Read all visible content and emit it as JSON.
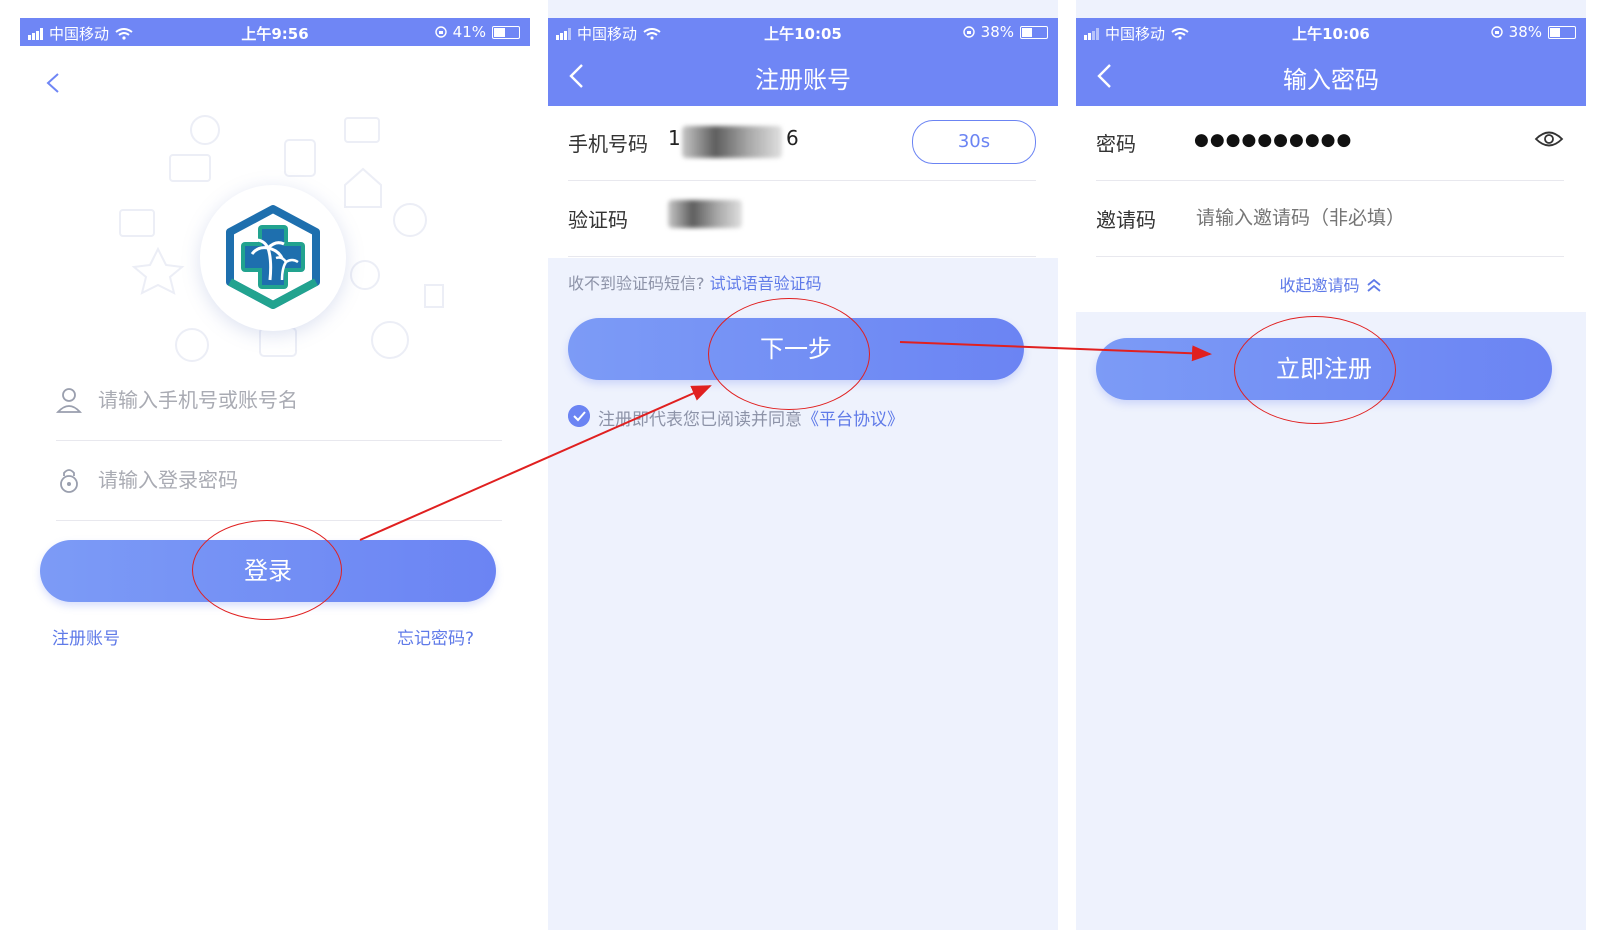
{
  "screens": [
    {
      "id": "login",
      "status": {
        "carrier": "中国移动",
        "time": "上午9:56",
        "battery": "41%",
        "battery_level": 0.41
      },
      "username_placeholder": "请输入手机号或账号名",
      "password_placeholder": "请输入登录密码",
      "login_button": "登录",
      "register_link": "注册账号",
      "forgot_link": "忘记密码?"
    },
    {
      "id": "register",
      "status": {
        "carrier": "中国移动",
        "time": "上午10:05",
        "battery": "38%",
        "battery_level": 0.38
      },
      "title": "注册账号",
      "phone_label": "手机号码",
      "phone_visible_prefix": "1",
      "phone_visible_suffix": "6",
      "countdown": "30s",
      "code_label": "验证码",
      "no_sms_hint": "收不到验证码短信?",
      "voice_code_link": "试试语音验证码",
      "next_button": "下一步",
      "agree_text": "注册即代表您已阅读并同意",
      "agreement_link": "《平台协议》",
      "agree_checked": true
    },
    {
      "id": "password",
      "status": {
        "carrier": "中国移动",
        "time": "上午10:06",
        "battery": "38%",
        "battery_level": 0.38
      },
      "title": "输入密码",
      "password_label": "密码",
      "password_value": "●●●●●●●●●●",
      "invite_label": "邀请码",
      "invite_placeholder": "请输入邀请码（非必填）",
      "collapse_invite": "收起邀请码",
      "register_button": "立即注册"
    }
  ],
  "colors": {
    "brand": "#6f86f5",
    "link": "#5f7ae8",
    "annotation": "#e02020",
    "page_bg": "#eef2fd"
  },
  "icons": [
    "signal-icon",
    "wifi-icon",
    "rotation-lock-icon",
    "battery-icon",
    "back-arrow-icon",
    "user-icon",
    "lock-icon",
    "eye-icon",
    "chevron-up-double-icon",
    "check-icon",
    "app-logo-icon"
  ]
}
